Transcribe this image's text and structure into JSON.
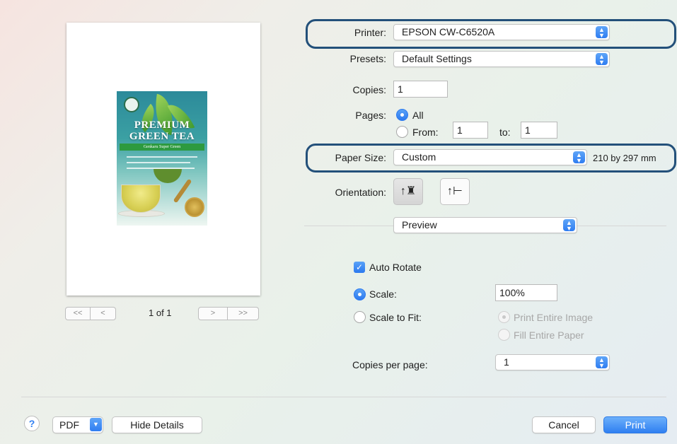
{
  "preview": {
    "label_text_1": "PREMIUM",
    "label_text_2": "GREEN TEA",
    "label_band": "Genkaru Super Green",
    "pager_first": "<<",
    "pager_prev": "<",
    "pager_next": ">",
    "pager_last": ">>",
    "page_count": "1 of 1"
  },
  "printer": {
    "label": "Printer:",
    "value": "EPSON CW-C6520A"
  },
  "presets": {
    "label": "Presets:",
    "value": "Default Settings"
  },
  "copies": {
    "label": "Copies:",
    "value": "1"
  },
  "pages": {
    "label": "Pages:",
    "all_label": "All",
    "from_label": "From:",
    "from_value": "1",
    "to_label": "to:",
    "to_value": "1"
  },
  "paper_size": {
    "label": "Paper Size:",
    "value": "Custom",
    "dimensions": "210 by 297 mm"
  },
  "orientation": {
    "label": "Orientation:",
    "portrait_glyph": "↑♜",
    "landscape_glyph": "↑⊢"
  },
  "section": {
    "value": "Preview"
  },
  "options": {
    "auto_rotate": "Auto Rotate",
    "scale_label": "Scale:",
    "scale_value": "100%",
    "scale_to_fit": "Scale to Fit:",
    "print_entire_image": "Print Entire Image",
    "fill_entire_paper": "Fill Entire Paper",
    "copies_per_page_label": "Copies per page:",
    "copies_per_page_value": "1"
  },
  "footer": {
    "help": "?",
    "pdf": "PDF",
    "hide_details": "Hide Details",
    "cancel": "Cancel",
    "print": "Print"
  },
  "colors": {
    "accent": "#2f7ff1",
    "highlight": "#23507a"
  }
}
